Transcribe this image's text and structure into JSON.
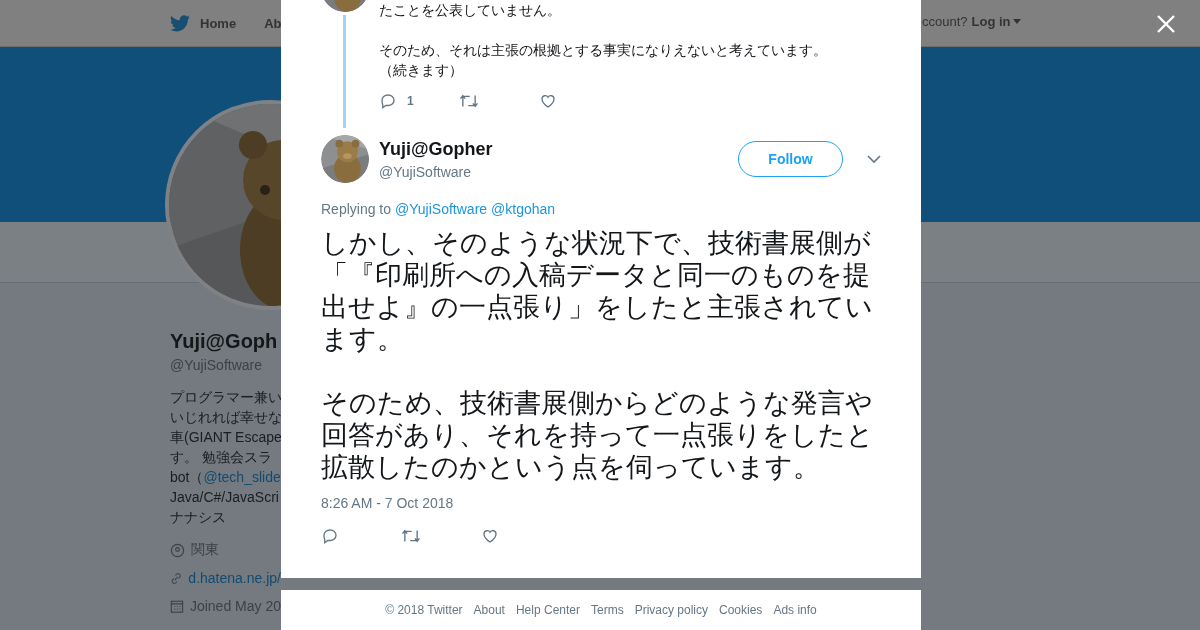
{
  "nav": {
    "items": [
      {
        "label": "Home"
      },
      {
        "label": "Ab"
      }
    ],
    "account_prompt": "ccount?",
    "login": "Log in"
  },
  "profile": {
    "name": "Yuji@Goph",
    "handle": "@YujiSoftware",
    "bio": [
      {
        "text": "プログラマー兼い"
      },
      {
        "text": "いじれれば幸せな"
      },
      {
        "text": "車(GIANT Escape"
      },
      {
        "text": "す。 勉強会スラ"
      },
      {
        "text": "bot（",
        "link": "@tech_slide"
      },
      {
        "text": "Java/C#/JavaScri"
      },
      {
        "text": "ナナシス"
      }
    ],
    "location": "関東",
    "website": "d.hatena.ne.jp/",
    "joined": "Joined May 20"
  },
  "previous_tweet": {
    "paragraphs": [
      [
        "たことを公表していません。"
      ],
      [
        "そのため、それは主張の根拠とする事実になりえないと考えています。",
        "（続きます）"
      ]
    ],
    "reply_count": "1"
  },
  "tweet": {
    "name": "Yuji@Gopher",
    "handle": "@YujiSoftware",
    "follow": "Follow",
    "replying_prefix": "Replying to",
    "mentions": [
      "@YujiSoftware",
      "@ktgohan"
    ],
    "paragraphs": [
      "しかし、そのような状況下で、技術書展側が「『印刷所への入稿データと同一のものを提出せよ』の一点張り」をしたと主張されています。",
      "そのため、技術書展側からどのような発言や回答があり、それを持って一点張りをしたと拡散したのかという点を伺っています。"
    ],
    "timestamp": "8:26 AM - 7 Oct 2018"
  },
  "footer": [
    "© 2018 Twitter",
    "About",
    "Help Center",
    "Terms",
    "Privacy policy",
    "Cookies",
    "Ads info"
  ]
}
